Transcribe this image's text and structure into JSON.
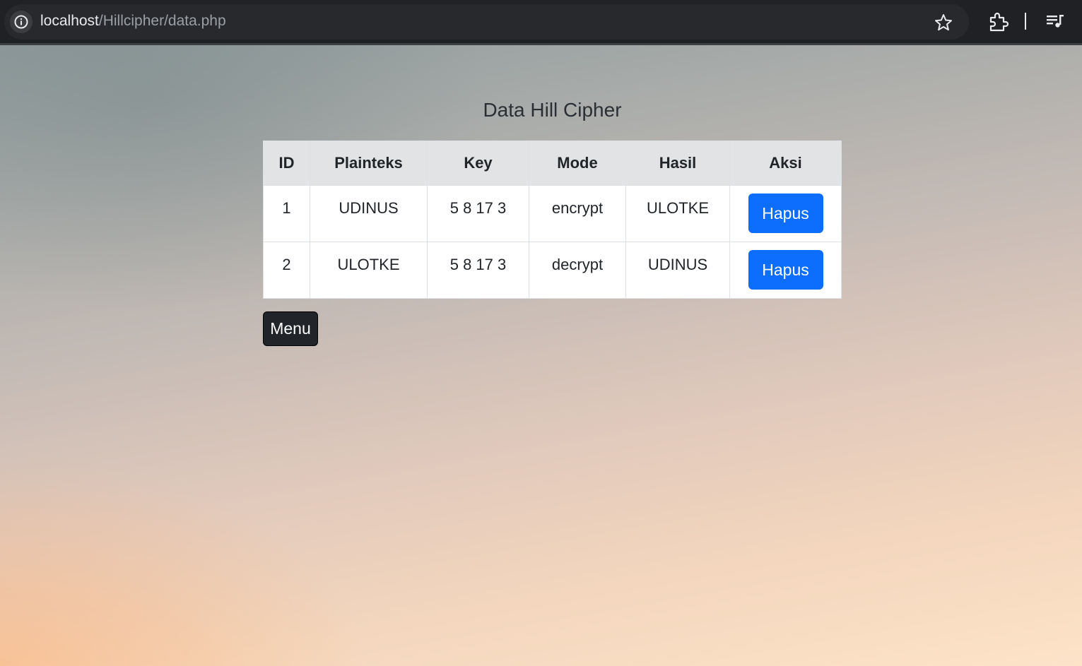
{
  "browser": {
    "url_host": "localhost",
    "url_path": "/Hillcipher/data.php",
    "icons": [
      "info-icon",
      "star-icon",
      "extensions-icon",
      "media-controls-icon"
    ]
  },
  "page": {
    "title": "Data Hill Cipher",
    "table": {
      "headers": [
        "ID",
        "Plainteks",
        "Key",
        "Mode",
        "Hasil",
        "Aksi"
      ],
      "rows": [
        {
          "id": "1",
          "plainteks": "UDINUS",
          "key": "5 8 17 3",
          "mode": "encrypt",
          "hasil": "ULOTKE",
          "action": "Hapus"
        },
        {
          "id": "2",
          "plainteks": "ULOTKE",
          "key": "5 8 17 3",
          "mode": "decrypt",
          "hasil": "UDINUS",
          "action": "Hapus"
        }
      ]
    },
    "menu_label": "Menu"
  },
  "colors": {
    "primary_button": "#0d6efd",
    "dark_button": "#212529",
    "table_header_bg": "#e2e3e5",
    "browser_chrome": "#202124"
  }
}
